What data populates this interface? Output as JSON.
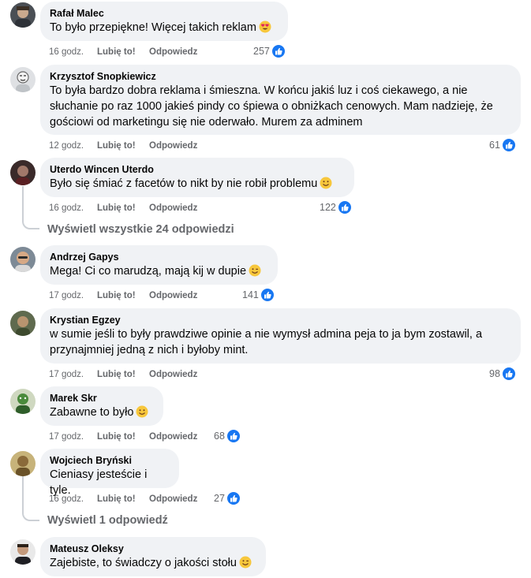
{
  "colors": {
    "bubble": "#f0f2f5",
    "like_blue": "#1877f2",
    "meta_gray": "#65676b"
  },
  "comments": [
    {
      "author": "Rafał Malec",
      "text": "To było przepiękne! Więcej takich reklam",
      "emoji": "heart-eyes",
      "time": "16 godz.",
      "like": "Lubię to!",
      "reply": "Odpowiedz",
      "reactions": "257"
    },
    {
      "author": "Krzysztof Snopkiewicz",
      "lines": [
        "To była bardzo dobra reklama i śmieszna. W końcu jakiś luz i coś ciekawego, a nie",
        "słuchanie po raz 1000 jakieś pindy co śpiewa o obniżkach cenowych. Mam nadzieję, że",
        "gościowi od marketingu się nie oderwało. Murem za adminem"
      ],
      "time": "12 godz.",
      "like": "Lubię to!",
      "reply": "Odpowiedz",
      "reactions": "61"
    },
    {
      "author": "Uterdo Wincen Uterdo",
      "text": "Było się śmiać z facetów to nikt by nie robił problemu",
      "emoji": "smile",
      "time": "16 godz.",
      "like": "Lubię to!",
      "reply": "Odpowiedz",
      "reactions": "122",
      "view_replies": "Wyświetl wszystkie 24 odpowiedzi"
    },
    {
      "author": "Andrzej Gapys",
      "text": "Mega! Ci co marudzą, mają kij w dupie",
      "emoji": "wink",
      "time": "17 godz.",
      "like": "Lubię to!",
      "reply": "Odpowiedz",
      "reactions": "141"
    },
    {
      "author": "Krystian Egzey",
      "lines": [
        "w sumie jeśli to były prawdziwe opinie a nie wymysł admina peja to ja bym zostawil, a",
        "przynajmniej jedną z nich i byłoby mint."
      ],
      "time": "17 godz.",
      "like": "Lubię to!",
      "reply": "Odpowiedz",
      "reactions": "98"
    },
    {
      "author": "Marek Skr",
      "text": "Zabawne to było",
      "emoji": "smile",
      "time": "17 godz.",
      "like": "Lubię to!",
      "reply": "Odpowiedz",
      "reactions": "68"
    },
    {
      "author": "Wojciech Bryński",
      "text": "Cieniasy jesteście i tyle.",
      "time": "16 godz.",
      "like": "Lubię to!",
      "reply": "Odpowiedz",
      "reactions": "27",
      "view_replies": "Wyświetl 1 odpowiedź"
    },
    {
      "author": "Mateusz Oleksy",
      "text": "Zajebiste, to świadczy o jakości stołu",
      "emoji": "wink"
    }
  ]
}
